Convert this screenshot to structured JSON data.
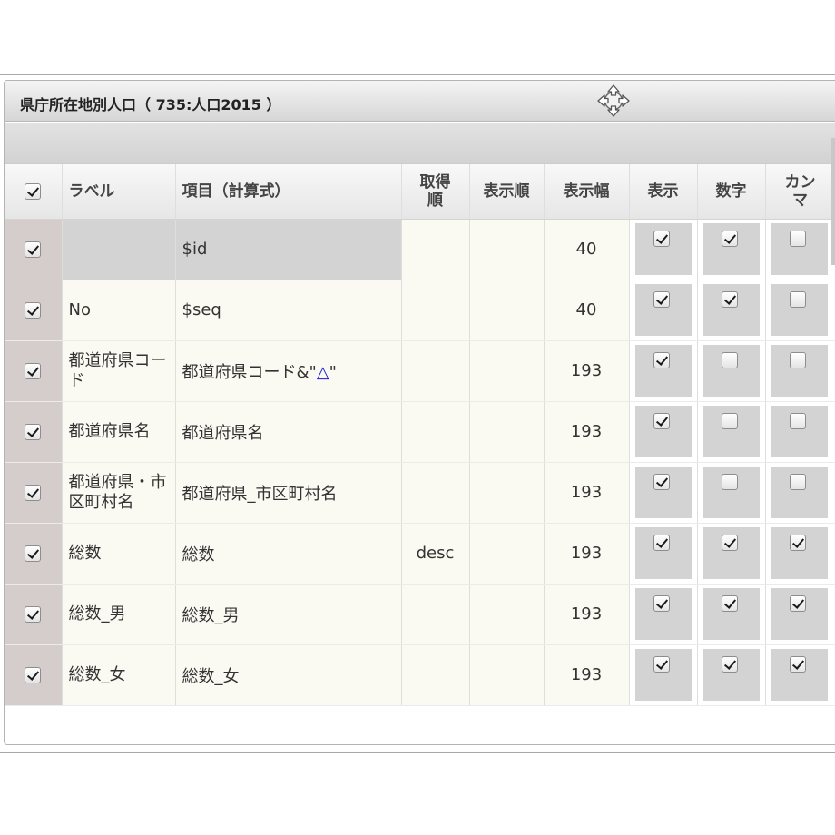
{
  "window": {
    "title": "県庁所在地別人口（ 735:人口2015 ）"
  },
  "icons": {
    "move": "move-arrows-icon",
    "checkbox": "checkbox-icon",
    "triangle": "delta-triangle-icon"
  },
  "colors": {
    "label_column_bg": "#d5cdcc",
    "row_bg": "#faf9f2",
    "toggle_bg": "#d3d3d3",
    "triangle": "#1414d0"
  },
  "table": {
    "select_all_checked": true,
    "headers": {
      "label": "ラベル",
      "expression": "項目（計算式）",
      "fetch_order_line1": "取得",
      "fetch_order_line2": "順",
      "display_order": "表示順",
      "display_width": "表示幅",
      "show": "表示",
      "number": "数字",
      "comma_line1": "カン",
      "comma_line2": "マ"
    },
    "rows": [
      {
        "checked": true,
        "label": "",
        "expression": "$id",
        "fetch_order": "",
        "display_order": "",
        "width": "40",
        "show": true,
        "number": true,
        "comma": false
      },
      {
        "checked": true,
        "label": "No",
        "expression": "$seq",
        "fetch_order": "",
        "display_order": "",
        "width": "40",
        "show": true,
        "number": true,
        "comma": false
      },
      {
        "checked": true,
        "label": "都道府県コード",
        "expression_prefix": "都道府県コード&\"",
        "expression_symbol": "△",
        "expression_suffix": "\"",
        "fetch_order": "",
        "display_order": "",
        "width": "193",
        "show": true,
        "number": false,
        "comma": false
      },
      {
        "checked": true,
        "label": "都道府県名",
        "expression": "都道府県名",
        "fetch_order": "",
        "display_order": "",
        "width": "193",
        "show": true,
        "number": false,
        "comma": false
      },
      {
        "checked": true,
        "label": "都道府県・市区町村名",
        "expression": "都道府県_市区町村名",
        "fetch_order": "",
        "display_order": "",
        "width": "193",
        "show": true,
        "number": false,
        "comma": false
      },
      {
        "checked": true,
        "label": "総数",
        "expression": "総数",
        "fetch_order": "desc",
        "display_order": "",
        "width": "193",
        "show": true,
        "number": true,
        "comma": true
      },
      {
        "checked": true,
        "label": "総数_男",
        "expression": "総数_男",
        "fetch_order": "",
        "display_order": "",
        "width": "193",
        "show": true,
        "number": true,
        "comma": true
      },
      {
        "checked": true,
        "label": "総数_女",
        "expression": "総数_女",
        "fetch_order": "",
        "display_order": "",
        "width": "193",
        "show": true,
        "number": true,
        "comma": true
      }
    ]
  }
}
